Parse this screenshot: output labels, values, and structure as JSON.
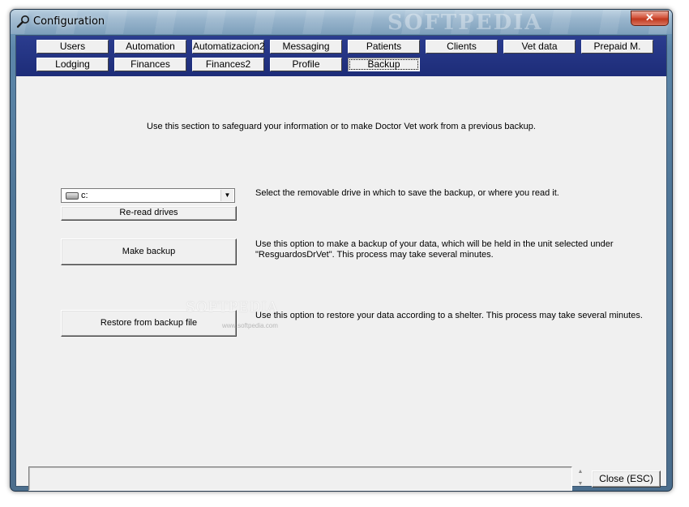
{
  "window": {
    "title": "Configuration",
    "watermark": "SOFTPEDIA",
    "close_glyph": "✕"
  },
  "tabs": [
    {
      "label": "Users"
    },
    {
      "label": "Automation"
    },
    {
      "label": "Automatizacion2"
    },
    {
      "label": "Messaging"
    },
    {
      "label": "Patients"
    },
    {
      "label": "Clients"
    },
    {
      "label": "Vet data"
    },
    {
      "label": "Prepaid M."
    },
    {
      "label": "Lodging"
    },
    {
      "label": "Finances"
    },
    {
      "label": "Finances2"
    },
    {
      "label": "Profile"
    },
    {
      "label": "Backup",
      "active": true
    }
  ],
  "backup": {
    "intro": "Use this section to safeguard your information or to make Doctor Vet work from a previous backup.",
    "drive": {
      "icon": "drive-icon",
      "selected": "c:",
      "description": "Select the removable drive in which to save the backup, or where you read it."
    },
    "reread_label": "Re-read drives",
    "make_backup": {
      "label": "Make backup",
      "description_line1": "Use this option to make a backup of your data, which will be held in the unit selected under",
      "description_line2": "\"ResguardosDrVet\". This process may take several minutes."
    },
    "restore": {
      "label": "Restore from backup file",
      "description": "Use this option to restore your data according to a shelter. This process may take several minutes."
    }
  },
  "footer": {
    "close_label": "Close (ESC)",
    "status_text": ""
  },
  "watermarks": {
    "center": "SOFTPEDIA",
    "small": "www.softpedia.com"
  },
  "colors": {
    "tab_band": "#1d2c78",
    "client_bg": "#f0f0f0",
    "close_red": "#c0391f"
  }
}
